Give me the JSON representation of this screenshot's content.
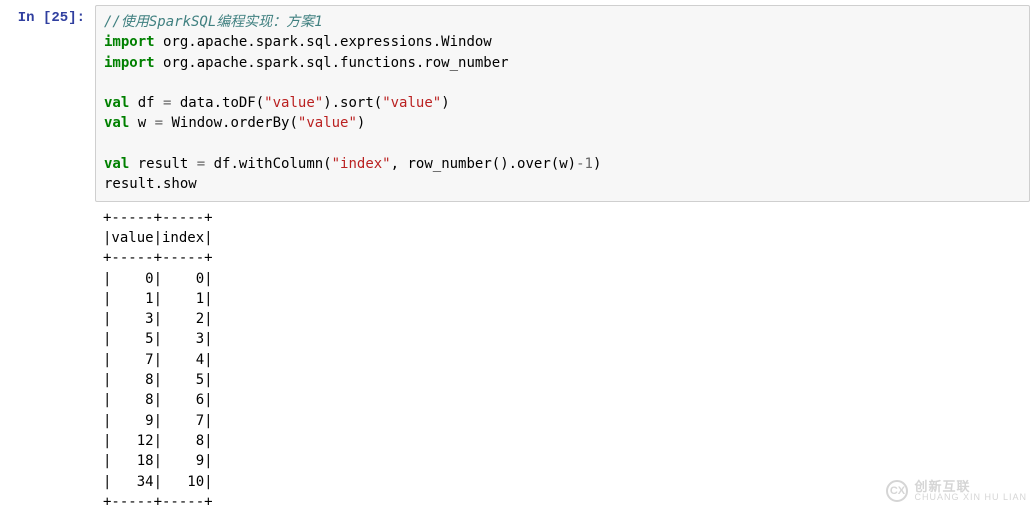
{
  "prompt": {
    "label": "In [25]:"
  },
  "code": {
    "comment": "//使用SparkSQL编程实现：方案1",
    "import_kw": "import",
    "import1_pkg": " org.apache.spark.sql.expressions.Window",
    "import2_pkg": " org.apache.spark.sql.functions.row_number",
    "val_kw": "val",
    "df_name": " df ",
    "eq": "=",
    "df_expr_a": " data.toDF(",
    "str_value1": "\"value\"",
    "df_expr_b": ").sort(",
    "str_value2": "\"value\"",
    "df_expr_c": ")",
    "w_name": " w ",
    "w_expr_a": " Window.orderBy(",
    "str_value3": "\"value\"",
    "w_expr_b": ")",
    "result_name": " result ",
    "res_expr_a": " df.withColumn(",
    "str_index": "\"index\"",
    "res_comma": ", row_number().over(w)",
    "minus": "-",
    "one": "1",
    "res_close": ")",
    "show": "result.show"
  },
  "output": {
    "sep": "+-----+-----+",
    "header": "|value|index|",
    "rows": [
      "|    0|    0|",
      "|    1|    1|",
      "|    3|    2|",
      "|    5|    3|",
      "|    7|    4|",
      "|    8|    5|",
      "|    8|    6|",
      "|    9|    7|",
      "|   12|    8|",
      "|   18|    9|",
      "|   34|   10|"
    ]
  },
  "chart_data": {
    "type": "table",
    "columns": [
      "value",
      "index"
    ],
    "rows": [
      [
        0,
        0
      ],
      [
        1,
        1
      ],
      [
        3,
        2
      ],
      [
        5,
        3
      ],
      [
        7,
        4
      ],
      [
        8,
        5
      ],
      [
        8,
        6
      ],
      [
        9,
        7
      ],
      [
        12,
        8
      ],
      [
        18,
        9
      ],
      [
        34,
        10
      ]
    ]
  },
  "watermark": {
    "logo": "CX",
    "cn": "创新互联",
    "en": "CHUANG XIN HU LIAN"
  }
}
